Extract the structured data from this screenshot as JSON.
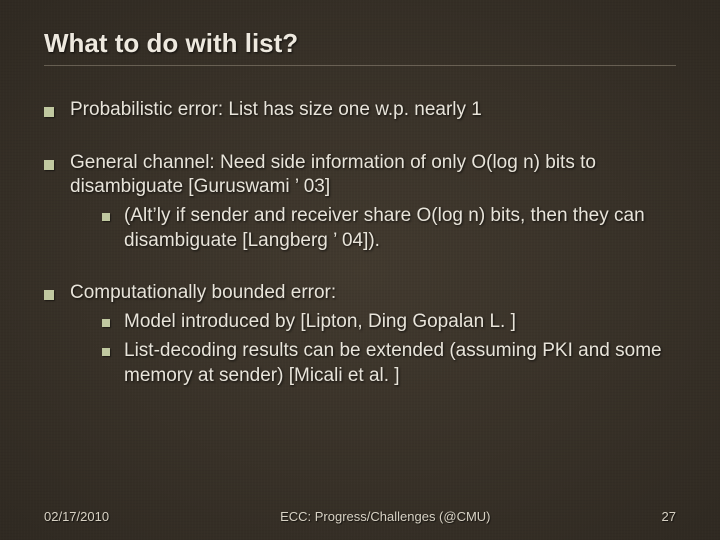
{
  "title": "What to do with list?",
  "bullets": {
    "b1": "Probabilistic error: List has size one w.p. nearly 1",
    "b2": "General channel: Need side information of only O(log n) bits to disambiguate [Guruswami ’ 03]",
    "b2a": "(Alt’ly if sender and receiver share O(log n) bits, then they can disambiguate [Langberg ’ 04]).",
    "b3": "Computationally bounded error:",
    "b3a": "Model introduced by [Lipton, Ding Gopalan L. ]",
    "b3b": "List-decoding results can be extended (assuming PKI and some memory at sender) [Micali et al. ]"
  },
  "footer": {
    "date": "02/17/2010",
    "center": "ECC: Progress/Challenges (@CMU)",
    "page": "27"
  }
}
